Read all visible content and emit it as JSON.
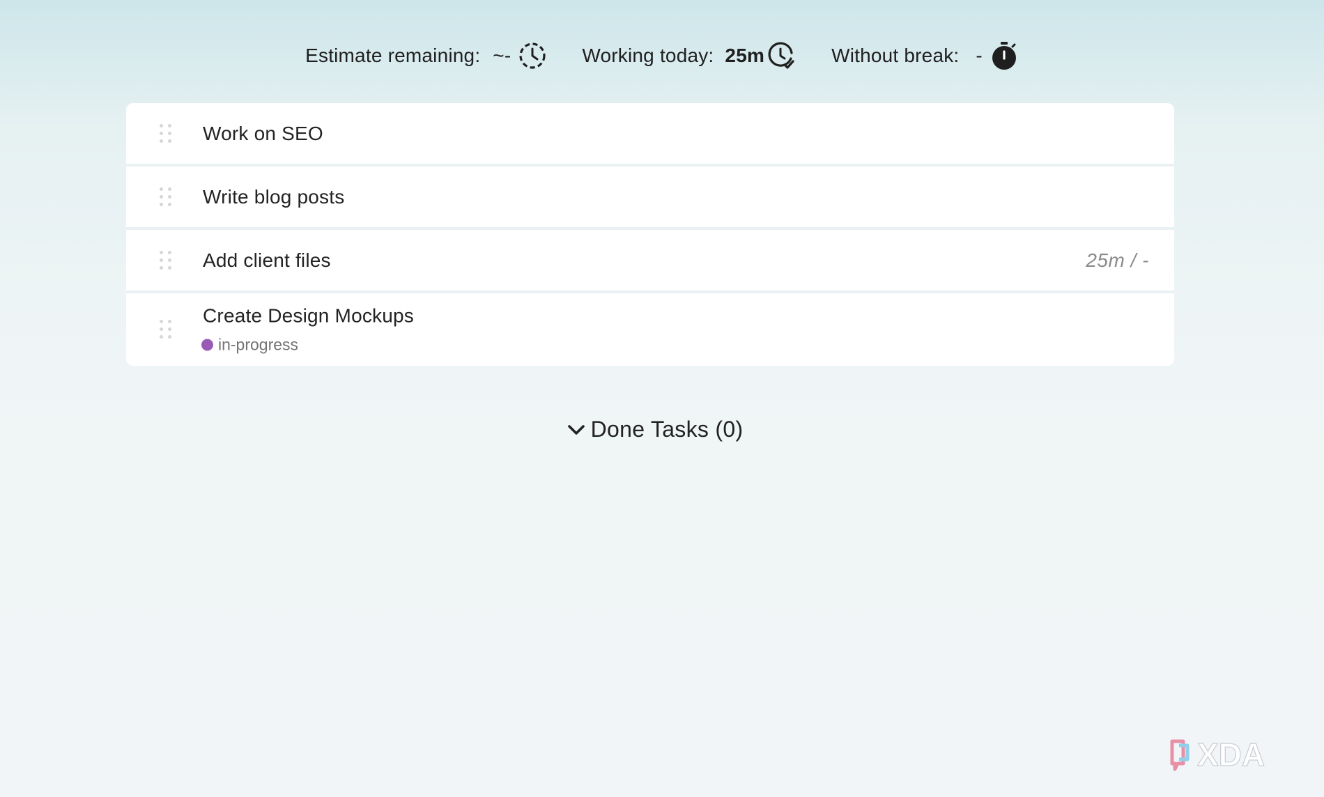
{
  "metrics": {
    "estimate": {
      "label": "Estimate remaining:",
      "value": "~-",
      "icon": "dashed-clock-icon"
    },
    "working": {
      "label": "Working today:",
      "value": "25m",
      "icon": "clock-check-icon"
    },
    "break": {
      "label": "Without break:",
      "value": "-",
      "icon": "stopwatch-icon"
    }
  },
  "tasks": [
    {
      "title": "Work on SEO"
    },
    {
      "title": "Write blog posts"
    },
    {
      "title": "Add client files",
      "time": "25m / -"
    },
    {
      "title": "Create Design Mockups",
      "tag": {
        "label": "in-progress",
        "color": "#9b59b6"
      }
    }
  ],
  "done_tasks": {
    "label": "Done Tasks (0)",
    "icon": "chevron-down-icon"
  },
  "watermark": {
    "text": "XDA"
  }
}
